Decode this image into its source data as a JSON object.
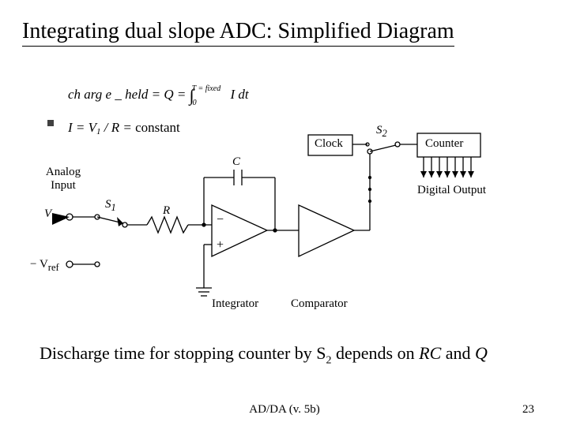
{
  "title": "Integrating dual slope ADC: Simplified Diagram",
  "equations": {
    "charge": "ch arg e _ held = Q = ∫₀^(T = fixed) I dt",
    "current": "I = V₁ / R = constant"
  },
  "diagram": {
    "labels": {
      "analog_input": "Analog\nInput",
      "v1": "V₁",
      "vref": "− Vref",
      "s1": "S₁",
      "r": "R",
      "c": "C",
      "integrator": "Integrator",
      "comparator": "Comparator",
      "clock": "Clock",
      "s2": "S₂",
      "counter": "Counter",
      "digital_output": "Digital Output"
    }
  },
  "caption": {
    "pre": "Discharge time for stopping counter by S",
    "sub": "2",
    "mid": " depends on ",
    "rc": "RC",
    "and": " and ",
    "q": "Q"
  },
  "footer": {
    "center": "AD/DA (v. 5b)",
    "page": "23"
  }
}
